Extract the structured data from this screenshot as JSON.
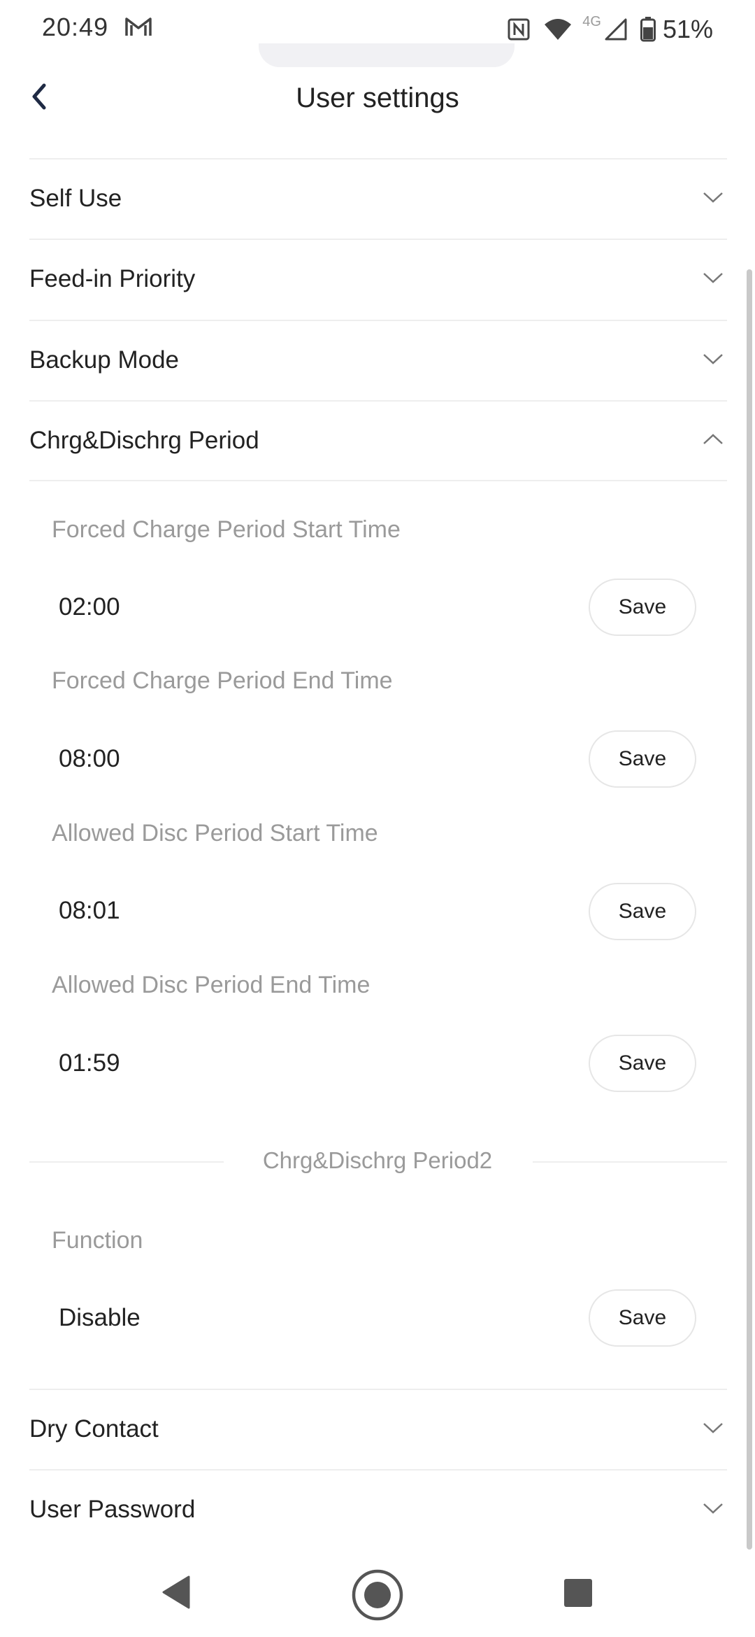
{
  "status_bar": {
    "time": "20:49",
    "network_label": "4G",
    "battery": "51%"
  },
  "header": {
    "title": "User settings"
  },
  "sections": {
    "self_use": "Self Use",
    "feed_in_priority": "Feed-in Priority",
    "backup_mode": "Backup Mode",
    "chrg_dischrg_period": "Chrg&Dischrg Period",
    "dry_contact": "Dry Contact",
    "user_password": "User Password"
  },
  "period1": {
    "forced_charge_start": {
      "label": "Forced Charge Period Start Time",
      "value": "02:00"
    },
    "forced_charge_end": {
      "label": "Forced Charge Period End Time",
      "value": "08:00"
    },
    "allowed_disc_start": {
      "label": "Allowed Disc Period Start Time",
      "value": "08:01"
    },
    "allowed_disc_end": {
      "label": "Allowed Disc Period End Time",
      "value": "01:59"
    }
  },
  "period2": {
    "title": "Chrg&Dischrg Period2",
    "function": {
      "label": "Function",
      "value": "Disable"
    }
  },
  "buttons": {
    "save": "Save"
  },
  "icons": {
    "back": "chevron-left-icon",
    "collapsed": "chevron-down-icon",
    "expanded": "chevron-up-icon"
  },
  "colors": {
    "text_primary": "#222222",
    "text_secondary": "#9a9a9a",
    "divider": "#eeeeee",
    "accent_dark_blue": "#1f2a44"
  }
}
